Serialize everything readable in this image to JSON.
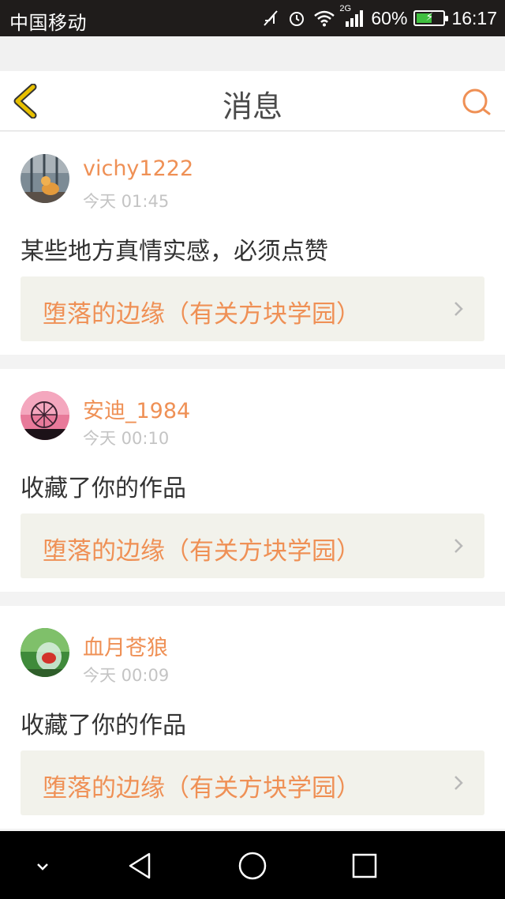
{
  "status_bar": {
    "carrier": "中国移动",
    "network_type": "2G",
    "battery_percent": "60%",
    "battery_level": 0.6,
    "time": "16:17"
  },
  "header": {
    "title": "消息",
    "back_icon": "chevron-left-icon",
    "search_icon": "search-icon"
  },
  "messages": [
    {
      "username": "vichy1222",
      "time": "今天 01:45",
      "text": "某些地方真情实感，必须点赞",
      "work_title": "堕落的边缘（有关方块学园）",
      "avatar": "cat-photo"
    },
    {
      "username": "安迪_1984",
      "time": "今天 00:10",
      "text": "收藏了你的作品",
      "work_title": "堕落的边缘（有关方块学园）",
      "avatar": "ferris-wheel-photo"
    },
    {
      "username": "血月苍狼",
      "time": "今天 00:09",
      "text": "收藏了你的作品",
      "work_title": "堕落的边缘（有关方块学园）",
      "avatar": "fish-bowl-photo"
    }
  ],
  "colors": {
    "accent": "#ef9055",
    "back_icon": "#e8c000",
    "card_link_bg": "#f2f2eb"
  },
  "system_nav": [
    "hide-keyboard-icon",
    "back-triangle-icon",
    "home-circle-icon",
    "recents-square-icon"
  ]
}
